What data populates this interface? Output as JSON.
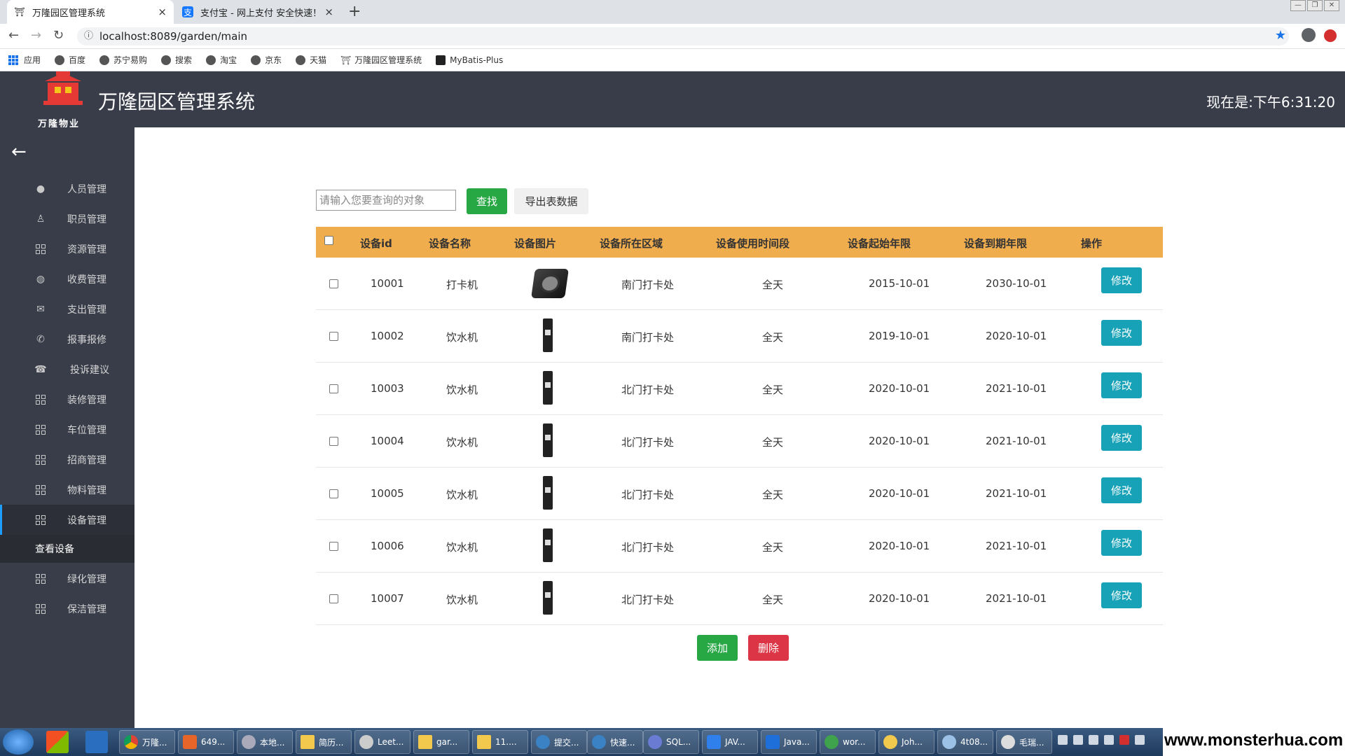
{
  "browser": {
    "tabs": [
      {
        "label": "万隆园区管理系统",
        "active": true
      },
      {
        "label": "支付宝 - 网上支付 安全快速！",
        "active": false
      }
    ],
    "url": "localhost:8089/garden/main",
    "bookmarks": [
      "应用",
      "百度",
      "苏宁易购",
      "搜索",
      "淘宝",
      "京东",
      "天猫",
      "万隆园区管理系统",
      "MyBatis-Plus"
    ]
  },
  "header": {
    "logo_text": "万隆物业",
    "title": "万隆园区管理系统",
    "clock": "现在是:下午6:31:20"
  },
  "sidebar": {
    "items": [
      {
        "label": "人员管理",
        "icon": "person-icon"
      },
      {
        "label": "职员管理",
        "icon": "staff-icon"
      },
      {
        "label": "资源管理",
        "icon": "grid-icon"
      },
      {
        "label": "收费管理",
        "icon": "globe-icon"
      },
      {
        "label": "支出管理",
        "icon": "mail-icon"
      },
      {
        "label": "报事报修",
        "icon": "phone-icon"
      },
      {
        "label": "投诉建议",
        "icon": "telephone-icon"
      },
      {
        "label": "装修管理",
        "icon": "grid-icon"
      },
      {
        "label": "车位管理",
        "icon": "grid-icon"
      },
      {
        "label": "招商管理",
        "icon": "grid-icon"
      },
      {
        "label": "物料管理",
        "icon": "grid-icon"
      },
      {
        "label": "设备管理",
        "icon": "grid-icon",
        "active": true
      },
      {
        "label": "绿化管理",
        "icon": "grid-icon"
      },
      {
        "label": "保洁管理",
        "icon": "grid-icon"
      }
    ],
    "subitem": "查看设备"
  },
  "search": {
    "placeholder": "请输入您要查询的对象",
    "search_label": "查找",
    "export_label": "导出表数据"
  },
  "table": {
    "headers": [
      "设备id",
      "设备名称",
      "设备图片",
      "设备所在区域",
      "设备使用时间段",
      "设备起始年限",
      "设备到期年限",
      "操作"
    ],
    "rows": [
      {
        "id": "10001",
        "name": "打卡机",
        "image": "punch-clock",
        "area": "南门打卡处",
        "period": "全天",
        "start": "2015-10-01",
        "end": "2030-10-01"
      },
      {
        "id": "10002",
        "name": "饮水机",
        "image": "water-dispenser",
        "area": "南门打卡处",
        "period": "全天",
        "start": "2019-10-01",
        "end": "2020-10-01"
      },
      {
        "id": "10003",
        "name": "饮水机",
        "image": "water-dispenser",
        "area": "北门打卡处",
        "period": "全天",
        "start": "2020-10-01",
        "end": "2021-10-01"
      },
      {
        "id": "10004",
        "name": "饮水机",
        "image": "water-dispenser",
        "area": "北门打卡处",
        "period": "全天",
        "start": "2020-10-01",
        "end": "2021-10-01"
      },
      {
        "id": "10005",
        "name": "饮水机",
        "image": "water-dispenser",
        "area": "北门打卡处",
        "period": "全天",
        "start": "2020-10-01",
        "end": "2021-10-01"
      },
      {
        "id": "10006",
        "name": "饮水机",
        "image": "water-dispenser",
        "area": "北门打卡处",
        "period": "全天",
        "start": "2020-10-01",
        "end": "2021-10-01"
      },
      {
        "id": "10007",
        "name": "饮水机",
        "image": "water-dispenser",
        "area": "北门打卡处",
        "period": "全天",
        "start": "2020-10-01",
        "end": "2021-10-01"
      }
    ],
    "edit_label": "修改"
  },
  "actions": {
    "add_label": "添加",
    "delete_label": "删除"
  },
  "taskbar": {
    "tasks": [
      "万隆...",
      "649...",
      "本地...",
      "简历...",
      "Leet...",
      "gar...",
      "11....",
      "提交...",
      "快速...",
      "SQL...",
      "JAV...",
      "Java...",
      "wor...",
      "Joh...",
      "4t08...",
      "毛瑞..."
    ]
  },
  "watermark": "www.monsterhua.com",
  "colors": {
    "header_bg": "#393d49",
    "table_header": "#f0ad4e",
    "search_button": "#28a745",
    "edit_button": "#17a2b8",
    "delete_button": "#dc3545",
    "active_indicator": "#1e9fff"
  }
}
